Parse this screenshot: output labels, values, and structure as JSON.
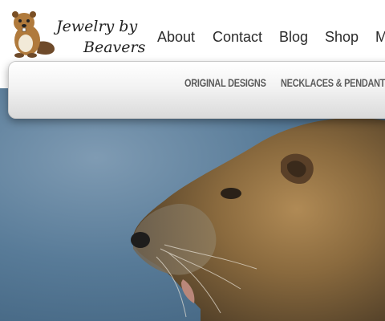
{
  "brand": {
    "line1": "Jewelry by",
    "line2": "Beavers",
    "logo_icon": "beaver-icon"
  },
  "top_nav": {
    "items": [
      {
        "label": "About"
      },
      {
        "label": "Contact"
      },
      {
        "label": "Blog"
      },
      {
        "label": "Shop"
      },
      {
        "label": "M"
      }
    ]
  },
  "sub_nav": {
    "items": [
      {
        "label": "ORIGINAL DESIGNS"
      },
      {
        "label": "NECKLACES & PENDANTS"
      }
    ]
  },
  "hero": {
    "subject": "nutria-photo"
  },
  "colors": {
    "water": "#587b98",
    "fur": "#8a6a3e",
    "nav_text": "#2b2b2b",
    "sub_nav_text": "#5a5a5a"
  }
}
